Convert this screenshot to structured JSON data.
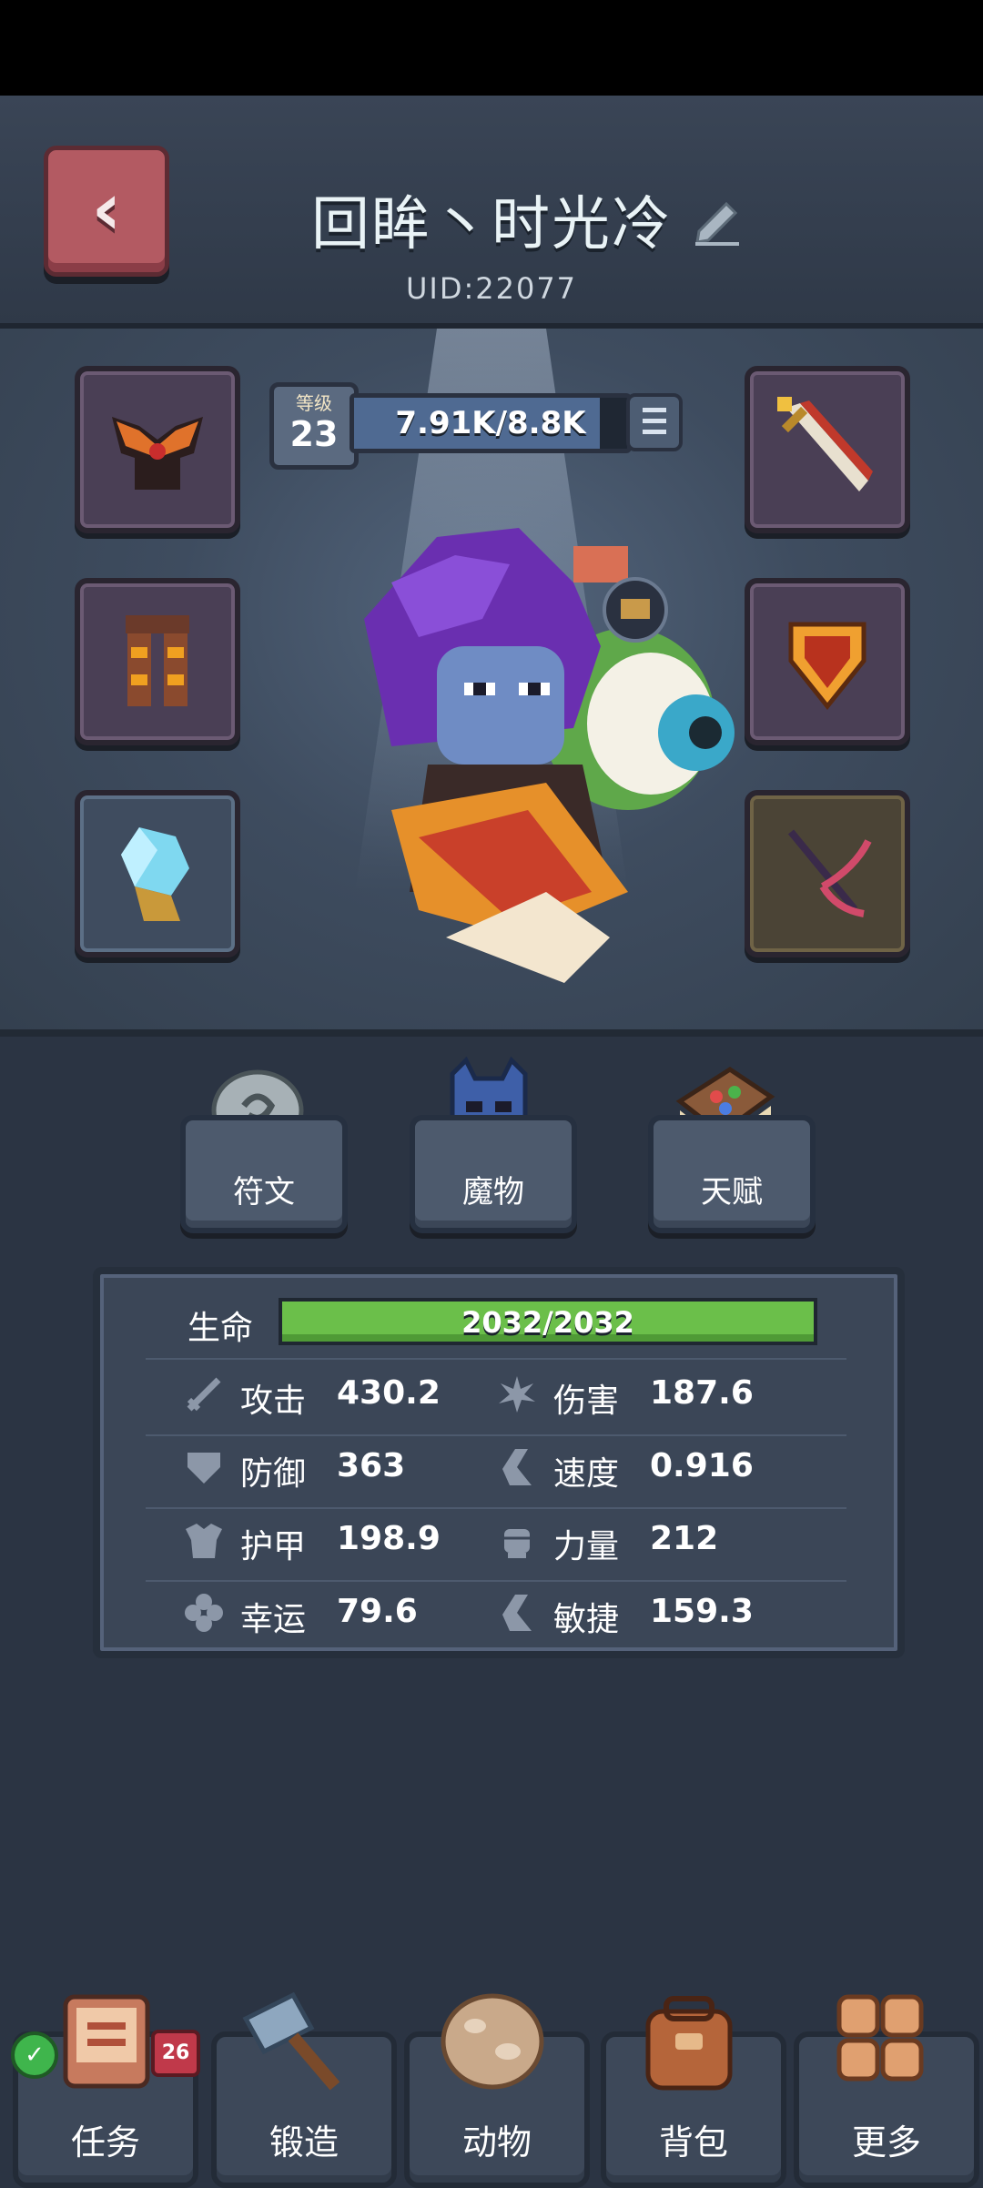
{
  "player": {
    "name": "回眸丶时光冷",
    "uid": "UID:22077"
  },
  "level": {
    "label": "等级",
    "value": "23"
  },
  "xp": {
    "text": "7.91K/8.8K",
    "fraction": 0.899
  },
  "tabs": [
    {
      "label": "符文",
      "icon": "rune-stone-icon"
    },
    {
      "label": "魔物",
      "icon": "monster-icon"
    },
    {
      "label": "天赋",
      "icon": "talent-book-icon"
    }
  ],
  "stats": {
    "hp": {
      "label": "生命",
      "text": "2032/2032",
      "fraction": 1.0
    },
    "items": [
      {
        "name": "攻击",
        "value": "430.2",
        "icon": "sword-icon"
      },
      {
        "name": "伤害",
        "value": "187.6",
        "icon": "burst-icon"
      },
      {
        "name": "防御",
        "value": "363",
        "icon": "shield-icon"
      },
      {
        "name": "速度",
        "value": "0.916",
        "icon": "boot-icon"
      },
      {
        "name": "护甲",
        "value": "198.9",
        "icon": "armor-icon"
      },
      {
        "name": "力量",
        "value": "212",
        "icon": "fist-icon"
      },
      {
        "name": "幸运",
        "value": "79.6",
        "icon": "clover-icon"
      },
      {
        "name": "敏捷",
        "value": "159.3",
        "icon": "boot-icon"
      }
    ]
  },
  "nav": [
    {
      "label": "任务",
      "icon": "quest-scroll-icon",
      "badge": "26"
    },
    {
      "label": "锻造",
      "icon": "hammer-icon"
    },
    {
      "label": "动物",
      "icon": "egg-icon"
    },
    {
      "label": "背包",
      "icon": "backpack-icon"
    },
    {
      "label": "更多",
      "icon": "grid-icon"
    }
  ],
  "colors": {
    "hp_bar": "#6bbf4a",
    "back_button": "#b35a62",
    "background": "#2b3443"
  }
}
